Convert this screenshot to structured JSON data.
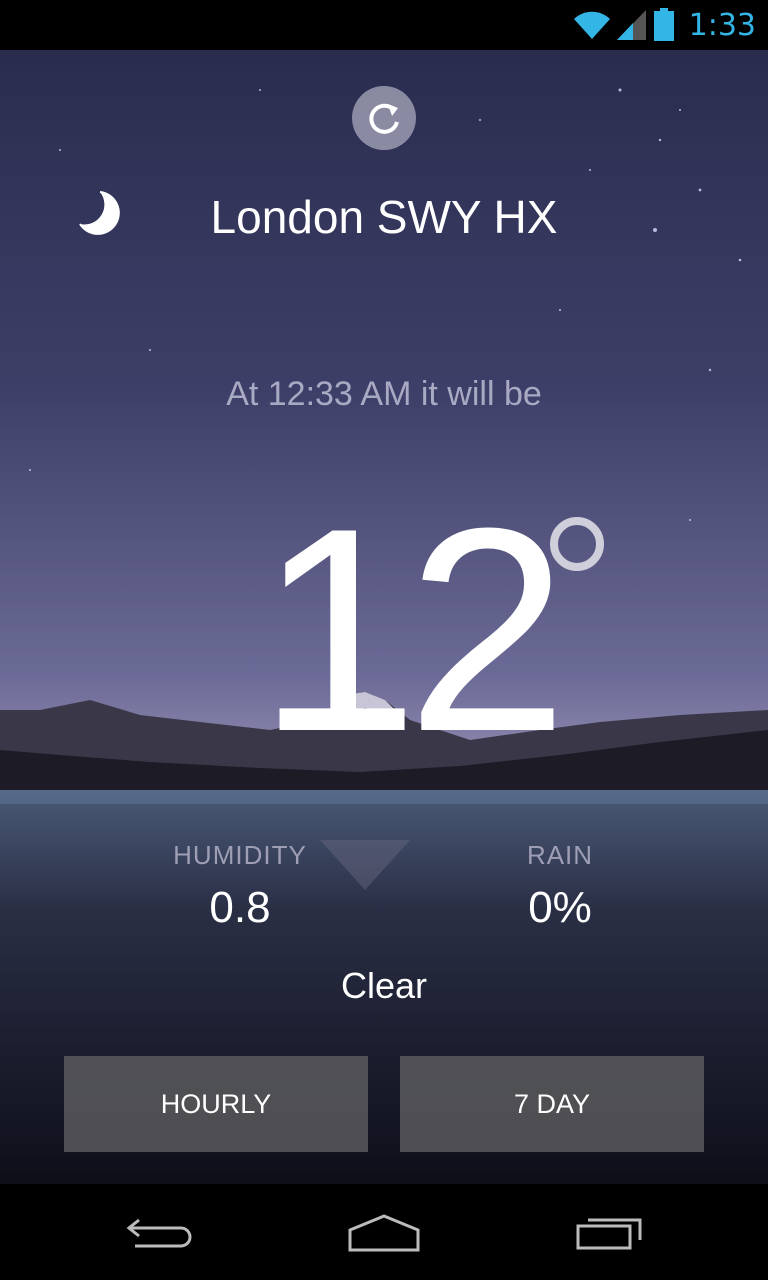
{
  "status_bar": {
    "time": "1:33",
    "accent_color": "#33b5e5",
    "icons": [
      "wifi-icon",
      "signal-icon",
      "battery-icon"
    ]
  },
  "weather": {
    "location": "London SWY HX",
    "forecast_time_text": "At 12:33 AM it will be",
    "temperature": "12",
    "humidity": {
      "label": "HUMIDITY",
      "value": "0.8"
    },
    "rain": {
      "label": "RAIN",
      "value": "0%"
    },
    "condition": "Clear",
    "condition_icon": "moon-icon"
  },
  "actions": {
    "refresh_icon": "refresh-icon",
    "hourly_label": "HOURLY",
    "seven_day_label": "7 DAY"
  },
  "navigation": {
    "icons": [
      "back-icon",
      "home-icon",
      "recent-apps-icon"
    ]
  }
}
